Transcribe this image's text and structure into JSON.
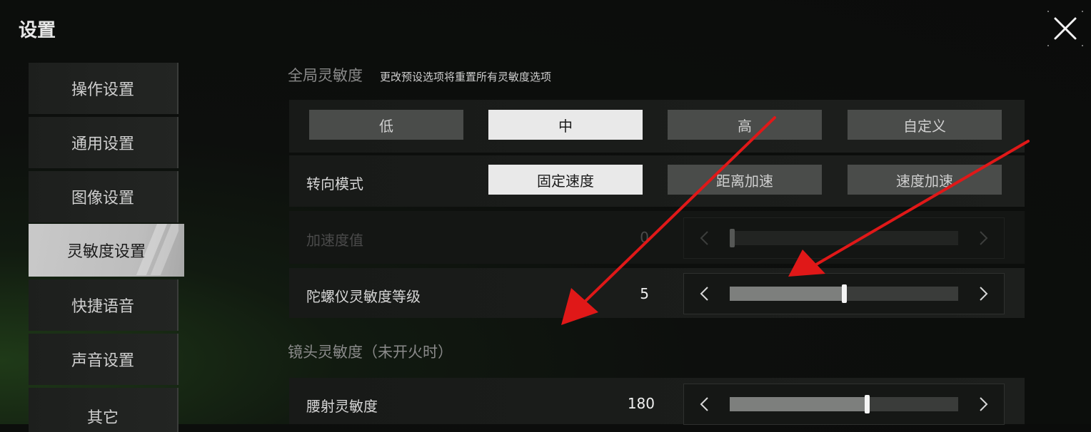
{
  "header": {
    "title": "设置",
    "close_icon": "close-icon"
  },
  "sidebar": {
    "items": [
      {
        "label": "操作设置",
        "active": false
      },
      {
        "label": "通用设置",
        "active": false
      },
      {
        "label": "图像设置",
        "active": false
      },
      {
        "label": "灵敏度设置",
        "active": true
      },
      {
        "label": "快捷语音",
        "active": false
      },
      {
        "label": "声音设置",
        "active": false
      },
      {
        "label": "其它",
        "active": false
      }
    ]
  },
  "global": {
    "title": "全局灵敏度",
    "subtitle": "更改预设选项将重置所有灵敏度选项",
    "presets": [
      {
        "label": "低",
        "selected": false
      },
      {
        "label": "中",
        "selected": true
      },
      {
        "label": "高",
        "selected": false
      },
      {
        "label": "自定义",
        "selected": false
      }
    ],
    "turn_mode": {
      "label": "转向模式",
      "options": [
        {
          "label": "固定速度",
          "selected": true
        },
        {
          "label": "距离加速",
          "selected": false
        },
        {
          "label": "速度加速",
          "selected": false
        }
      ]
    },
    "accel": {
      "label": "加速度值",
      "value": "0",
      "fraction": 0.0,
      "disabled": true
    },
    "gyro": {
      "label": "陀螺仪灵敏度等级",
      "value": "5",
      "fraction": 0.5
    }
  },
  "camera": {
    "title": "镜头灵敏度（未开火时）",
    "hip": {
      "label": "腰射灵敏度",
      "value": "180",
      "fraction": 0.6
    }
  },
  "colors": {
    "accent_selected": "#e9e9e9",
    "annotation_arrow": "#e01818"
  }
}
